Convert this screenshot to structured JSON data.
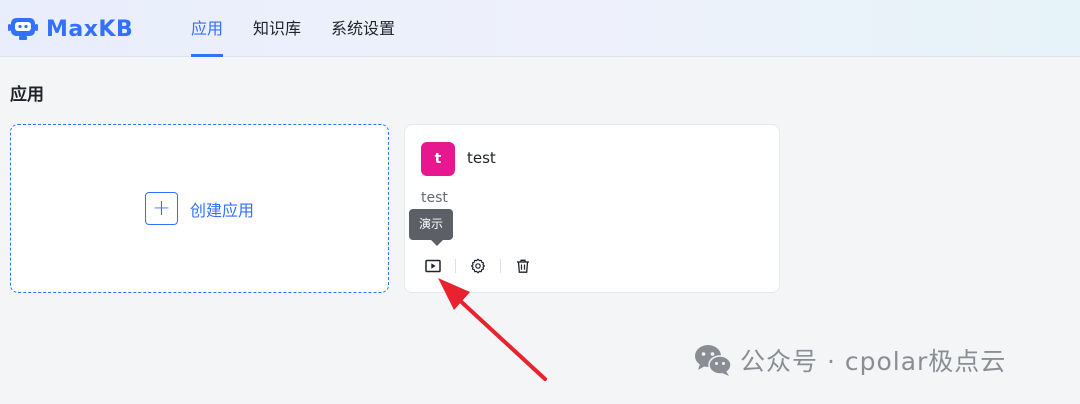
{
  "header": {
    "logo_text": "MaxKB",
    "nav": [
      {
        "label": "应用",
        "active": true
      },
      {
        "label": "知识库",
        "active": false
      },
      {
        "label": "系统设置",
        "active": false
      }
    ]
  },
  "main": {
    "title": "应用",
    "create_card": {
      "label": "创建应用"
    },
    "apps": [
      {
        "avatar_letter": "t",
        "avatar_color": "#e7188f",
        "name": "test",
        "description": "test",
        "tooltip": "演示",
        "actions": [
          {
            "icon": "play-icon"
          },
          {
            "icon": "gear-icon"
          },
          {
            "icon": "trash-icon"
          }
        ]
      }
    ]
  },
  "watermark": {
    "text": "公众号 · cpolar极点云"
  },
  "colors": {
    "accent": "#3370ff",
    "arrow": "#e8232f"
  }
}
